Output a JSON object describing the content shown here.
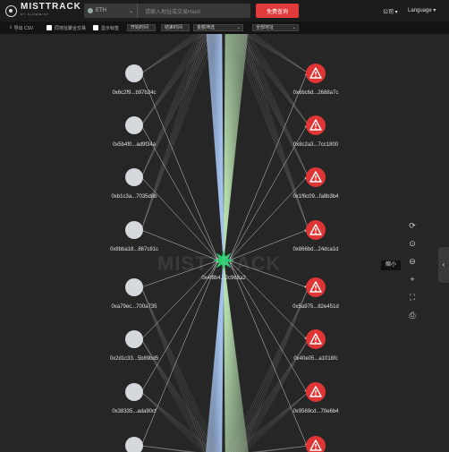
{
  "header": {
    "logo_text": "MISTTRACK",
    "logo_sub": "BY SLOWMIST",
    "chain": "ETH",
    "search_placeholder": "请输入地址或交易Hash",
    "search_button": "免费查询",
    "company": "公司",
    "language": "Language"
  },
  "toolbar": {
    "export_csv": "导出 CSV",
    "opt1": "同地址聚合交易",
    "opt2": "显示标签",
    "sel1": "开始时间",
    "sel2": "结束时间",
    "sel3": "金额筛选",
    "sel4": "全部地址"
  },
  "graph": {
    "center_label": "0x4f8b4...2c968a2",
    "center_color": "#2ecc71",
    "left_color": "#d5d8dc",
    "right_color": "#e03535",
    "left_nodes": [
      {
        "label": "0x6c2f9...b97b24c"
      },
      {
        "label": "0x5b4f0...ad9f34a"
      },
      {
        "label": "0xb1c3a...7035d8b"
      },
      {
        "label": "0x8bba18...867c81c"
      },
      {
        "label": "0xa79ec...700a735"
      },
      {
        "label": "0x2d1c33...5b89bd5"
      },
      {
        "label": "0x38335...ada90cf"
      },
      {
        "label": ""
      }
    ],
    "right_nodes": [
      {
        "label": "0x6bc6d...2688a7c"
      },
      {
        "label": "0x8c2a3...7cc1800"
      },
      {
        "label": "0x1f6c09...fa8b3b4"
      },
      {
        "label": "0x866bd...24dca1d"
      },
      {
        "label": "0x5a975...82e451d"
      },
      {
        "label": "0x40e05...a1018fc"
      },
      {
        "label": "0x9569cd...70e6b4"
      },
      {
        "label": ""
      }
    ],
    "watermark": "MISTTRACK"
  },
  "tools": {
    "icons": [
      "refresh-icon",
      "zoom-reset-icon",
      "zoom-out-icon",
      "zoom-in-icon",
      "fullscreen-icon",
      "print-icon"
    ],
    "tooltip": "缩小"
  }
}
